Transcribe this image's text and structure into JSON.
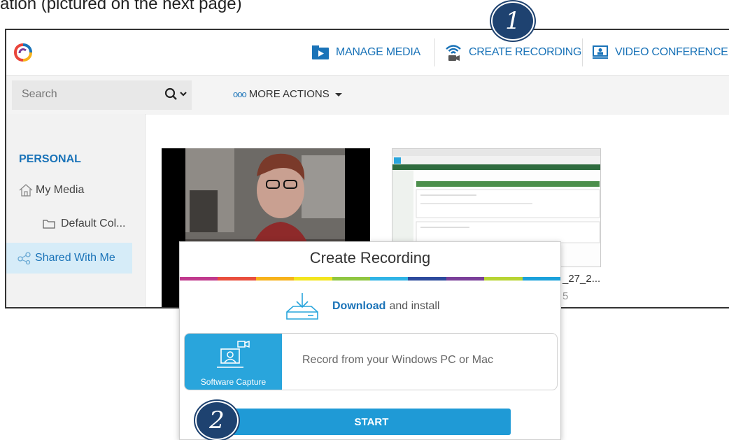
{
  "caption": "ation (pictured on the next page)",
  "nav": {
    "manage_media": "MANAGE MEDIA",
    "create_recording": "CREATE RECORDING",
    "video_conference": "VIDEO CONFERENCE"
  },
  "search": {
    "placeholder": "Search"
  },
  "more_actions": "MORE ACTIONS",
  "more_actions_dots": "ooo",
  "sidebar": {
    "title": "PERSONAL",
    "items": [
      {
        "label": "My Media",
        "icon": "home-icon"
      },
      {
        "label": "Default Col...",
        "icon": "folder-icon"
      },
      {
        "label": "Shared With Me",
        "icon": "share-icon",
        "active": true
      }
    ]
  },
  "media_cards": [
    {
      "label": "",
      "sub": ""
    },
    {
      "label": "_27_2...",
      "sub": "5"
    }
  ],
  "dialog": {
    "title": "Create Recording",
    "download_link": "Download",
    "download_text": "and install",
    "capture_tile_label": "Software Capture",
    "capture_text": "Record from your Windows PC or Mac",
    "start_label": "START",
    "rainbow_colors": [
      "#c0398d",
      "#e94e3d",
      "#f7b21b",
      "#f3e51d",
      "#8fc640",
      "#2fb4e6",
      "#2c4a9c",
      "#7a3f99",
      "#b7d432",
      "#1aa1db"
    ]
  },
  "badges": [
    "1",
    "2"
  ],
  "colors": {
    "accent": "#1a73b8",
    "badge": "#1e4270",
    "start": "#1f9ad6"
  }
}
